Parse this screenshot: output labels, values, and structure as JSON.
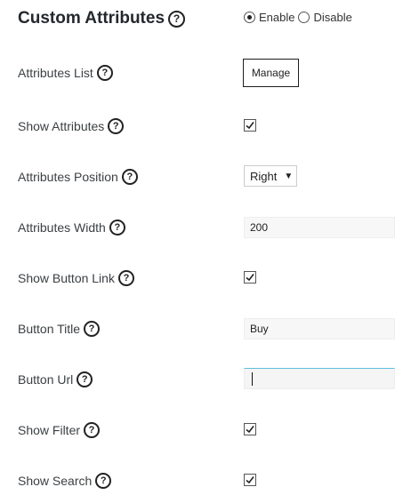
{
  "header": {
    "title": "Custom Attributes",
    "enable_label": "Enable",
    "disable_label": "Disable",
    "selected": "Enable"
  },
  "help_glyph": "?",
  "rows": {
    "attributes_list": {
      "label": "Attributes List",
      "button_label": "Manage"
    },
    "show_attributes": {
      "label": "Show Attributes",
      "checked": true
    },
    "attributes_position": {
      "label": "Attributes Position",
      "value": "Right",
      "arrow": "▼"
    },
    "attributes_width": {
      "label": "Attributes Width",
      "value": "200"
    },
    "show_button_link": {
      "label": "Show Button Link",
      "checked": true
    },
    "button_title": {
      "label": "Button Title",
      "value": "Buy"
    },
    "button_url": {
      "label": "Button Url",
      "value": ""
    },
    "show_filter": {
      "label": "Show Filter",
      "checked": true
    },
    "show_search": {
      "label": "Show Search",
      "checked": true
    }
  }
}
